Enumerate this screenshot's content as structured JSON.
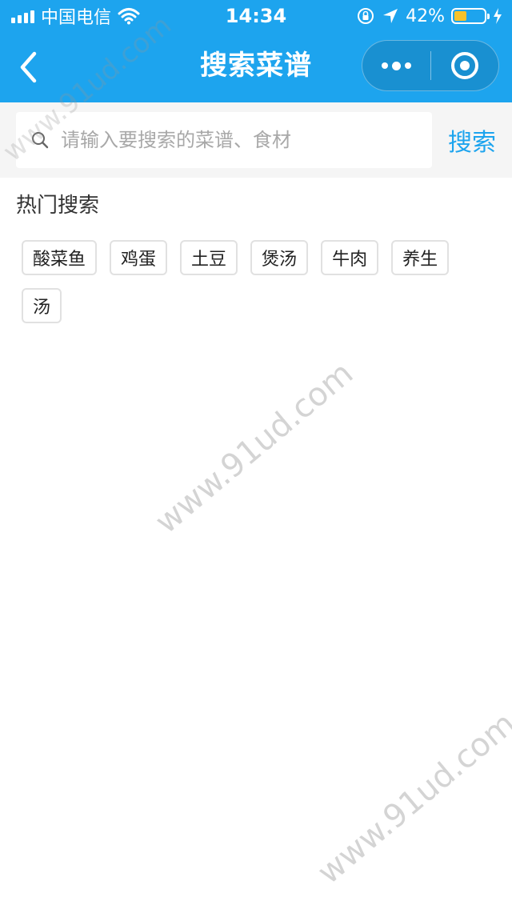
{
  "status_bar": {
    "carrier": "中国电信",
    "time": "14:34",
    "battery_percent": "42%",
    "battery_level": 0.42,
    "battery_color": "#f7c22a"
  },
  "nav": {
    "title": "搜索菜谱",
    "bar_color": "#1da4ee"
  },
  "search": {
    "placeholder": "请输入要搜索的菜谱、食材",
    "button_label": "搜索"
  },
  "hot": {
    "title": "热门搜索",
    "tags": [
      "酸菜鱼",
      "鸡蛋",
      "土豆",
      "煲汤",
      "牛肉",
      "养生",
      "汤"
    ]
  },
  "watermarks": [
    "www.91ud.com",
    "www.91ud.com",
    "www.91ud.com"
  ]
}
